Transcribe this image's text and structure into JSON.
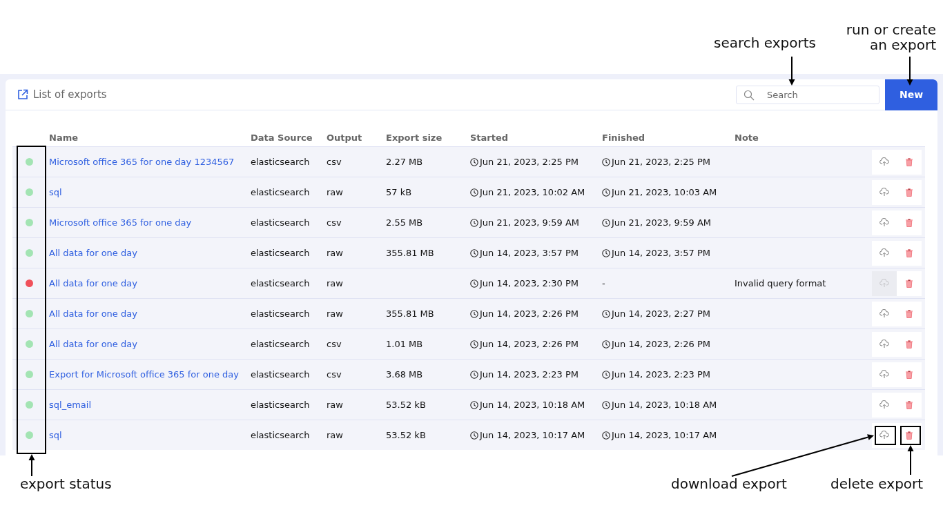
{
  "annotations": {
    "search": "search exports",
    "create": "run or create an export",
    "status": "export status",
    "download": "download export",
    "delete": "delete export"
  },
  "header": {
    "title": "List of exports",
    "search": {
      "placeholder": "Search"
    },
    "new_button": "New"
  },
  "table": {
    "columns": [
      "Name",
      "Data Source",
      "Output",
      "Export size",
      "Started",
      "Finished",
      "Note"
    ],
    "rows": [
      {
        "color": "#a3e4b3",
        "name": "Microsoft office 365 for one day 1234567",
        "source": "elasticsearch",
        "output": "csv",
        "size": "2.27 MB",
        "started": "Jun 21, 2023, 2:25 PM",
        "finished": "Jun 21, 2023, 2:25 PM",
        "download_disabled": false
      },
      {
        "color": "#a3e4b3",
        "name": "sql",
        "source": "elasticsearch",
        "output": "raw",
        "size": "57 kB",
        "started": "Jun 21, 2023, 10:02 AM",
        "finished": "Jun 21, 2023, 10:03 AM",
        "download_disabled": false
      },
      {
        "color": "#a3e4b3",
        "name": "Microsoft office 365 for one day",
        "source": "elasticsearch",
        "output": "csv",
        "size": "2.55 MB",
        "started": "Jun 21, 2023, 9:59 AM",
        "finished": "Jun 21, 2023, 9:59 AM",
        "download_disabled": false
      },
      {
        "color": "#a3e4b3",
        "name": "All data for one day",
        "source": "elasticsearch",
        "output": "raw",
        "size": "355.81 MB",
        "started": "Jun 14, 2023, 3:57 PM",
        "finished": "Jun 14, 2023, 3:57 PM",
        "download_disabled": false
      },
      {
        "color": "#f0505a",
        "name": "All data for one day",
        "source": "elasticsearch",
        "output": "raw",
        "started": "Jun 14, 2023, 2:30 PM",
        "finished": "-",
        "note": "Invalid query format",
        "download_disabled": true
      },
      {
        "color": "#a3e4b3",
        "name": "All data for one day",
        "source": "elasticsearch",
        "output": "raw",
        "size": "355.81 MB",
        "started": "Jun 14, 2023, 2:26 PM",
        "finished": "Jun 14, 2023, 2:27 PM",
        "download_disabled": false
      },
      {
        "color": "#a3e4b3",
        "name": "All data for one day",
        "source": "elasticsearch",
        "output": "csv",
        "size": "1.01 MB",
        "started": "Jun 14, 2023, 2:26 PM",
        "finished": "Jun 14, 2023, 2:26 PM",
        "download_disabled": false
      },
      {
        "color": "#a3e4b3",
        "name": "Export for Microsoft office 365 for one day",
        "source": "elasticsearch",
        "output": "csv",
        "size": "3.68 MB",
        "started": "Jun 14, 2023, 2:23 PM",
        "finished": "Jun 14, 2023, 2:23 PM",
        "download_disabled": false
      },
      {
        "color": "#a3e4b3",
        "name": "sql_email",
        "source": "elasticsearch",
        "output": "raw",
        "size": "53.52 kB",
        "started": "Jun 14, 2023, 10:18 AM",
        "finished": "Jun 14, 2023, 10:18 AM",
        "download_disabled": false
      },
      {
        "color": "#a3e4b3",
        "name": "sql",
        "source": "elasticsearch",
        "output": "raw",
        "size": "53.52 kB",
        "started": "Jun 14, 2023, 10:17 AM",
        "finished": "Jun 14, 2023, 10:17 AM",
        "download_disabled": false
      }
    ]
  }
}
